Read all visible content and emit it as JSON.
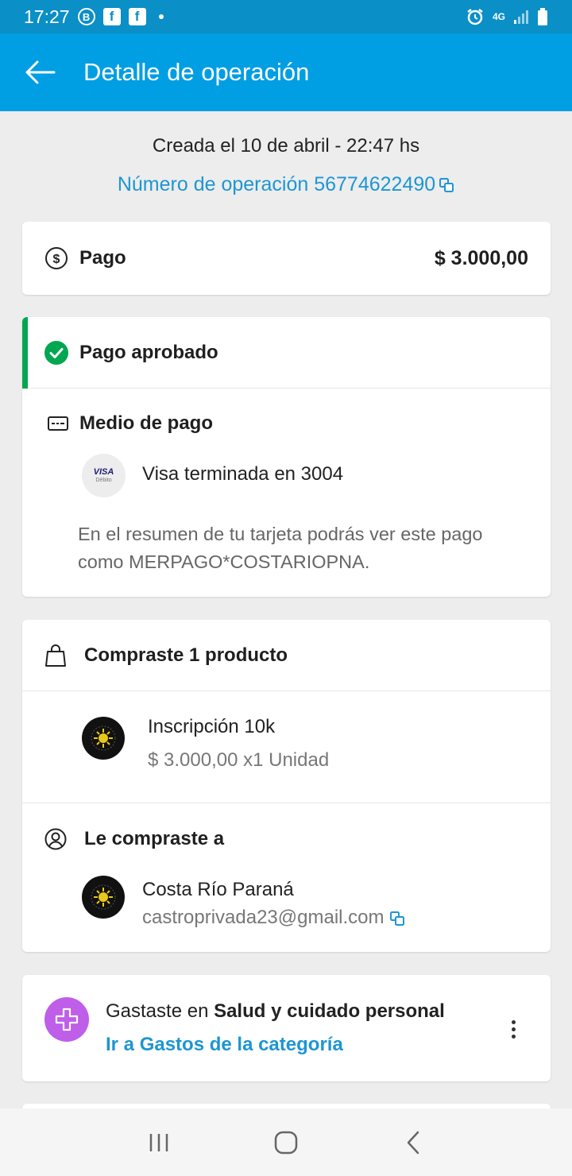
{
  "status_bar": {
    "time": "17:27",
    "b_label": "B",
    "f_label": "f",
    "network": "4G"
  },
  "app_bar": {
    "title": "Detalle de operación"
  },
  "operation": {
    "created": "Creada el 10 de abril - 22:47 hs",
    "number_label": "Número de operación 56774622490"
  },
  "payment": {
    "label": "Pago",
    "amount": "$ 3.000,00"
  },
  "status": {
    "label": "Pago aprobado",
    "color": "#00a650"
  },
  "payment_method": {
    "title": "Medio de pago",
    "card_brand": "VISA",
    "card_type": "Débito",
    "card_text": "Visa terminada en 3004",
    "statement_note": "En el resumen de tu tarjeta podrás ver este pago como MERPAGO*COSTARIOPNA."
  },
  "purchase": {
    "title": "Compraste 1 producto",
    "product_name": "Inscripción 10k",
    "product_price": "$ 3.000,00 x1 Unidad"
  },
  "seller": {
    "title": "Le compraste a",
    "name": "Costa Río Paraná",
    "email": "castroprivada23@gmail.com"
  },
  "category": {
    "prefix": "Gastaste en ",
    "name": "Salud y cuidado personal",
    "link": "Ir a Gastos de la categoría",
    "icon_color": "#bf5ee8"
  },
  "colors": {
    "primary": "#009ee3",
    "link": "#1d96d3",
    "status_bar": "#0a8fc6"
  }
}
